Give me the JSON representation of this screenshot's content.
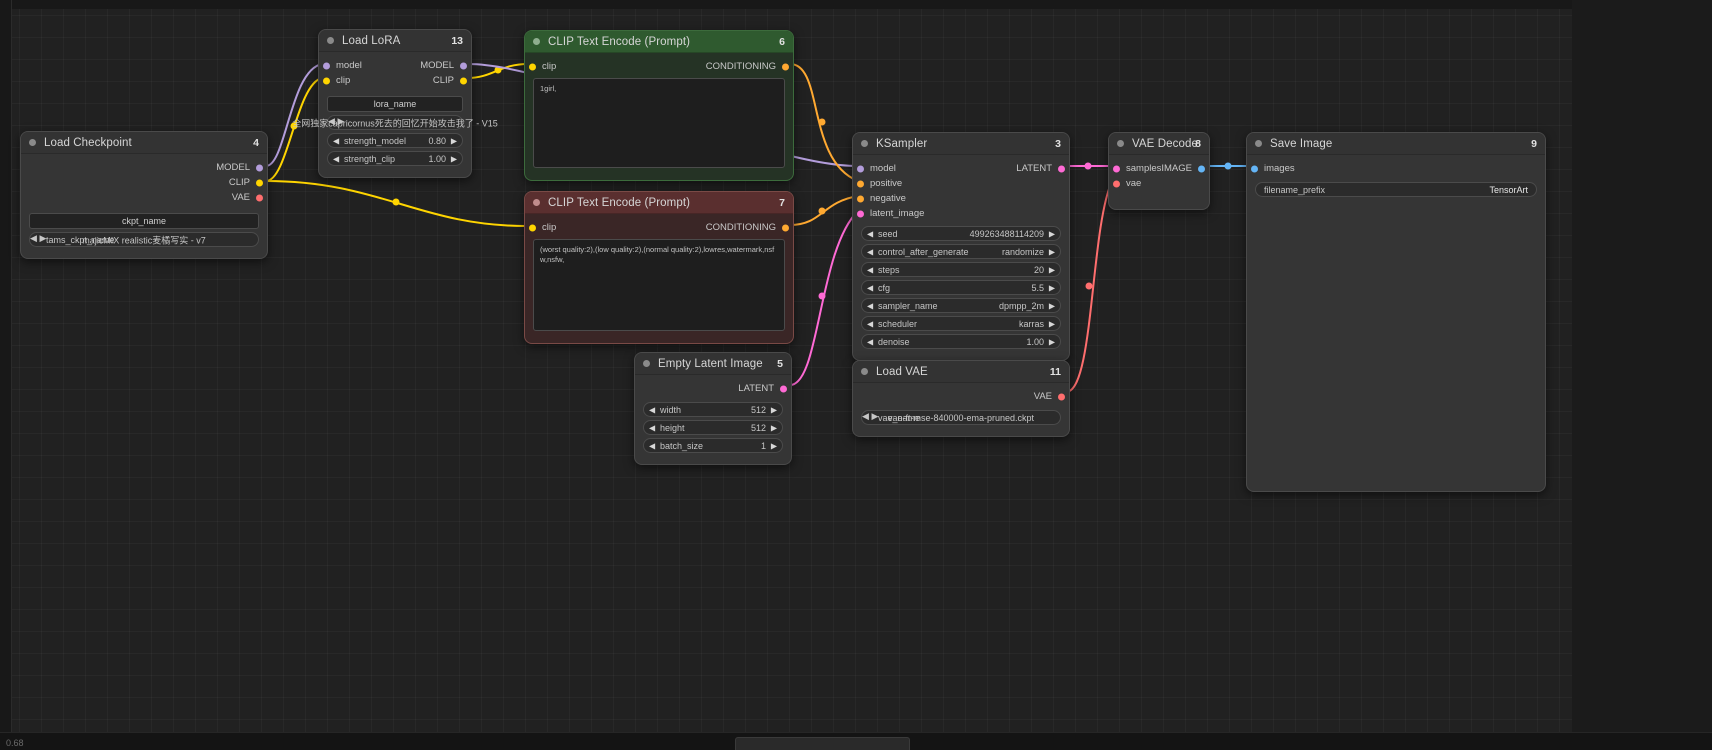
{
  "app": {
    "zoom_label": "0.68",
    "background": "#212121"
  },
  "colors": {
    "model": "#b39ddb",
    "clip": "#ffd500",
    "vae": "#ff6e6e",
    "conditioning": "#ffa931",
    "latent": "#ff6ad5",
    "image": "#64b5f6"
  },
  "nodes": {
    "load_checkpoint": {
      "title": "Load Checkpoint",
      "id": "4",
      "outputs": [
        {
          "label": "MODEL",
          "type": "model"
        },
        {
          "label": "CLIP",
          "type": "clip"
        },
        {
          "label": "VAE",
          "type": "vae"
        }
      ],
      "widget_label": "ckpt_name",
      "widget_name": "tams_ckpt_name",
      "widget_value": "majicMIX realistic麦橘写实 - v7"
    },
    "load_lora": {
      "title": "Load LoRA",
      "id": "13",
      "inputs": [
        {
          "label": "model",
          "type": "model"
        },
        {
          "label": "clip",
          "type": "clip"
        }
      ],
      "outputs": [
        {
          "label": "MODEL",
          "type": "model"
        },
        {
          "label": "CLIP",
          "type": "clip"
        }
      ],
      "widget_label": "lora_name",
      "lora_value": "全网独家capricornus死去的回忆开始攻击我了 - V15",
      "widgets": [
        {
          "name": "strength_model",
          "value": "0.80"
        },
        {
          "name": "strength_clip",
          "value": "1.00"
        }
      ]
    },
    "clip_encode_positive": {
      "title": "CLIP Text Encode (Prompt)",
      "id": "6",
      "input": {
        "label": "clip",
        "type": "clip"
      },
      "output": {
        "label": "CONDITIONING",
        "type": "conditioning"
      },
      "text": "1girl,"
    },
    "clip_encode_negative": {
      "title": "CLIP Text Encode (Prompt)",
      "id": "7",
      "input": {
        "label": "clip",
        "type": "clip"
      },
      "output": {
        "label": "CONDITIONING",
        "type": "conditioning"
      },
      "text": "(worst quality:2),(low quality:2),(normal quality:2),lowres,watermark,nsfw,nsfw,"
    },
    "empty_latent": {
      "title": "Empty Latent Image",
      "id": "5",
      "output": {
        "label": "LATENT",
        "type": "latent"
      },
      "widgets": [
        {
          "name": "width",
          "value": "512"
        },
        {
          "name": "height",
          "value": "512"
        },
        {
          "name": "batch_size",
          "value": "1"
        }
      ]
    },
    "ksampler": {
      "title": "KSampler",
      "id": "3",
      "inputs": [
        {
          "label": "model",
          "type": "model"
        },
        {
          "label": "positive",
          "type": "conditioning"
        },
        {
          "label": "negative",
          "type": "conditioning"
        },
        {
          "label": "latent_image",
          "type": "latent"
        }
      ],
      "output": {
        "label": "LATENT",
        "type": "latent"
      },
      "widgets": [
        {
          "name": "seed",
          "value": "499263488114209"
        },
        {
          "name": "control_after_generate",
          "value": "randomize"
        },
        {
          "name": "steps",
          "value": "20"
        },
        {
          "name": "cfg",
          "value": "5.5"
        },
        {
          "name": "sampler_name",
          "value": "dpmpp_2m"
        },
        {
          "name": "scheduler",
          "value": "karras"
        },
        {
          "name": "denoise",
          "value": "1.00"
        }
      ]
    },
    "load_vae": {
      "title": "Load VAE",
      "id": "11",
      "output": {
        "label": "VAE",
        "type": "vae"
      },
      "widget_name": "vae_name",
      "widget_value": "vae-ft-mse-840000-ema-pruned.ckpt"
    },
    "vae_decode": {
      "title": "VAE Decode",
      "id": "8",
      "inputs": [
        {
          "label": "samples",
          "type": "latent"
        },
        {
          "label": "vae",
          "type": "vae"
        }
      ],
      "output": {
        "label": "IMAGE",
        "type": "image"
      }
    },
    "save_image": {
      "title": "Save Image",
      "id": "9",
      "input": {
        "label": "images",
        "type": "image"
      },
      "widget_name": "filename_prefix",
      "widget_value": "TensorArt"
    }
  }
}
